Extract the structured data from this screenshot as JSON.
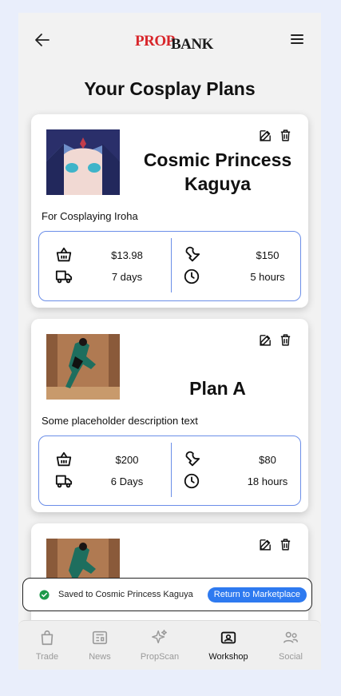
{
  "header": {
    "logo_prop": "PROP",
    "logo_bank": "BANK"
  },
  "page": {
    "title": "Your Cosplay Plans"
  },
  "plans": [
    {
      "name": "Cosmic Princess Kaguya",
      "description": "For Cosplaying Iroha",
      "cost": "$13.98",
      "shipping_time": "7 days",
      "labor_cost": "$150",
      "labor_time": "5 hours"
    },
    {
      "name": "Plan A",
      "description": "Some placeholder description text",
      "cost": "$200",
      "shipping_time": "6 Days",
      "labor_cost": "$80",
      "labor_time": "18 hours"
    },
    {
      "name": "",
      "description": ""
    }
  ],
  "toast": {
    "message": "Saved to Cosmic Princess Kaguya",
    "action": "Return to Marketplace"
  },
  "nav": [
    {
      "label": "Trade",
      "icon": "shopping-bag-icon"
    },
    {
      "label": "News",
      "icon": "newspaper-icon"
    },
    {
      "label": "PropScan",
      "icon": "sparkle-icon"
    },
    {
      "label": "Workshop",
      "icon": "workshop-icon",
      "active": true
    },
    {
      "label": "Social",
      "icon": "people-icon"
    }
  ],
  "colors": {
    "brand_red": "#d8262b",
    "accent_blue": "#2e7af0",
    "success_green": "#1f9a4b",
    "border_blue": "#6b8ee8"
  }
}
